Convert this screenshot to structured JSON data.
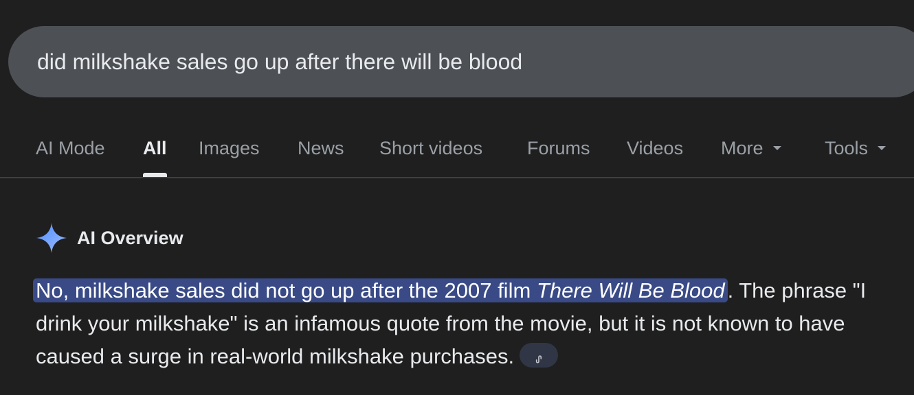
{
  "search": {
    "query": "did milkshake sales go up after there will be blood"
  },
  "tabs": [
    {
      "label": "AI Mode"
    },
    {
      "label": "All"
    },
    {
      "label": "Images"
    },
    {
      "label": "News"
    },
    {
      "label": "Short videos"
    },
    {
      "label": "Forums"
    },
    {
      "label": "Videos"
    },
    {
      "label": "More"
    },
    {
      "label": "Tools"
    }
  ],
  "active_tab": "All",
  "ai_overview": {
    "icon": "sparkle-icon",
    "title": "AI Overview",
    "highlight_prefix": "No, milkshake sales did not go up after the 2007 film ",
    "highlight_title": "There Will Be Blood",
    "body_rest": ". The phrase \"I drink your milkshake\" is an infamous quote from the movie, but it is not known to have caused a surge in real-world milkshake purchases.",
    "link_icon": "link-icon"
  },
  "colors": {
    "background": "#1f1f1f",
    "search_bar": "#4d5156",
    "highlight": "#394a86",
    "sparkle": "#6ea0ff",
    "inactive_tab": "#9aa0a6",
    "active_text": "#e8eaed"
  }
}
